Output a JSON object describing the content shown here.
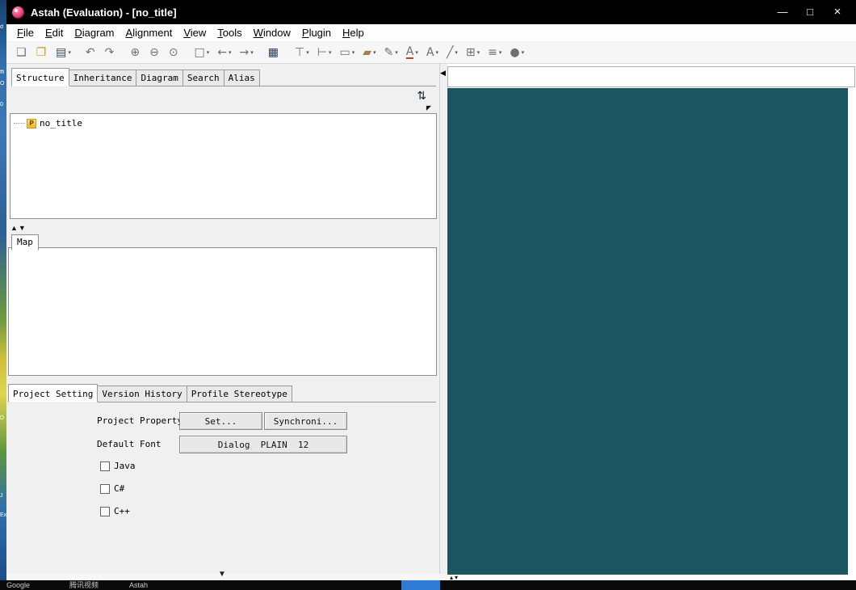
{
  "colors": {
    "titlebar_bg": "#000000",
    "editor_bg": "#1b5560",
    "taskbar_active": "#2e7cd6",
    "project_icon": "#f0b62c"
  },
  "window": {
    "title": "Astah (Evaluation) - [no_title]",
    "controls": {
      "minimize": "—",
      "maximize": "□",
      "close": "×"
    }
  },
  "menu": {
    "items": [
      "File",
      "Edit",
      "Diagram",
      "Alignment",
      "View",
      "Tools",
      "Window",
      "Plugin",
      "Help"
    ]
  },
  "toolbar": {
    "buttons": [
      {
        "name": "new-file",
        "glyph": "❏"
      },
      {
        "name": "open-folder",
        "glyph": "❐"
      },
      {
        "name": "save",
        "glyph": "▤",
        "caret": "▾"
      },
      {
        "name": "undo",
        "glyph": "↶"
      },
      {
        "name": "redo",
        "glyph": "↷"
      },
      {
        "name": "zoom-in",
        "glyph": "⊕"
      },
      {
        "name": "zoom-out",
        "glyph": "⊖"
      },
      {
        "name": "zoom-tool",
        "glyph": "⊙"
      },
      {
        "name": "select-area",
        "glyph": "□",
        "caret": "▾"
      },
      {
        "name": "navigate-back",
        "glyph": "←",
        "caret": "▾"
      },
      {
        "name": "navigate-forward",
        "glyph": "→",
        "caret": "▾"
      },
      {
        "name": "map-view",
        "glyph": "▦"
      },
      {
        "name": "align-vertical",
        "glyph": "⊤",
        "caret": "▾"
      },
      {
        "name": "align-horizontal",
        "glyph": "⊢",
        "caret": "▾"
      },
      {
        "name": "frame",
        "glyph": "▭",
        "caret": "▾"
      },
      {
        "name": "fill-color",
        "glyph": "▰",
        "caret": "▾"
      },
      {
        "name": "line-color",
        "glyph": "✎",
        "caret": "▾"
      },
      {
        "name": "font-color",
        "glyph": "A",
        "caret": "▾"
      },
      {
        "name": "font-style",
        "glyph": "A",
        "caret": "▾"
      },
      {
        "name": "line-shape",
        "glyph": "╱",
        "caret": "▾"
      },
      {
        "name": "grid-view",
        "glyph": "⊞",
        "caret": "▾"
      },
      {
        "name": "list-view",
        "glyph": "≡",
        "caret": "▾"
      },
      {
        "name": "junction",
        "glyph": "●",
        "caret": "▾"
      }
    ]
  },
  "left_panel": {
    "tabs": [
      "Structure",
      "Inheritance",
      "Diagram",
      "Search",
      "Alias"
    ],
    "active_tab": "Structure",
    "sync_icon": "⇅",
    "tree_collapse_icon": "◤",
    "tree": {
      "icon_glyph": "P",
      "root_label": "no_title"
    },
    "splitter_up": "▲",
    "splitter_down": "▼",
    "map_tab": "Map",
    "bottom_tabs": [
      "Project Setting",
      "Version History",
      "Profile Stereotype"
    ],
    "active_bottom_tab": "Project Setting",
    "project_setting": {
      "property_label": "Project Property",
      "set_button": "Set...",
      "sync_button": "Synchroni...",
      "font_label": "Default Font",
      "font_button": "Dialog  PLAIN  12",
      "languages": [
        {
          "label": "Java",
          "checked": false
        },
        {
          "label": "C#",
          "checked": false
        },
        {
          "label": "C++",
          "checked": false
        }
      ]
    },
    "collapse_bottom_icon": "▼"
  },
  "splitter": {
    "collapse_left_icon": "◀"
  },
  "right_panel": {
    "bottom_arrows": "▴▾"
  },
  "desktop": {
    "edge_labels": [
      "d",
      "ffi",
      "O",
      "0",
      "D",
      "J",
      "Ex"
    ]
  },
  "taskbar": {
    "items": [
      "Google",
      "腾讯视频",
      "Astah"
    ]
  }
}
